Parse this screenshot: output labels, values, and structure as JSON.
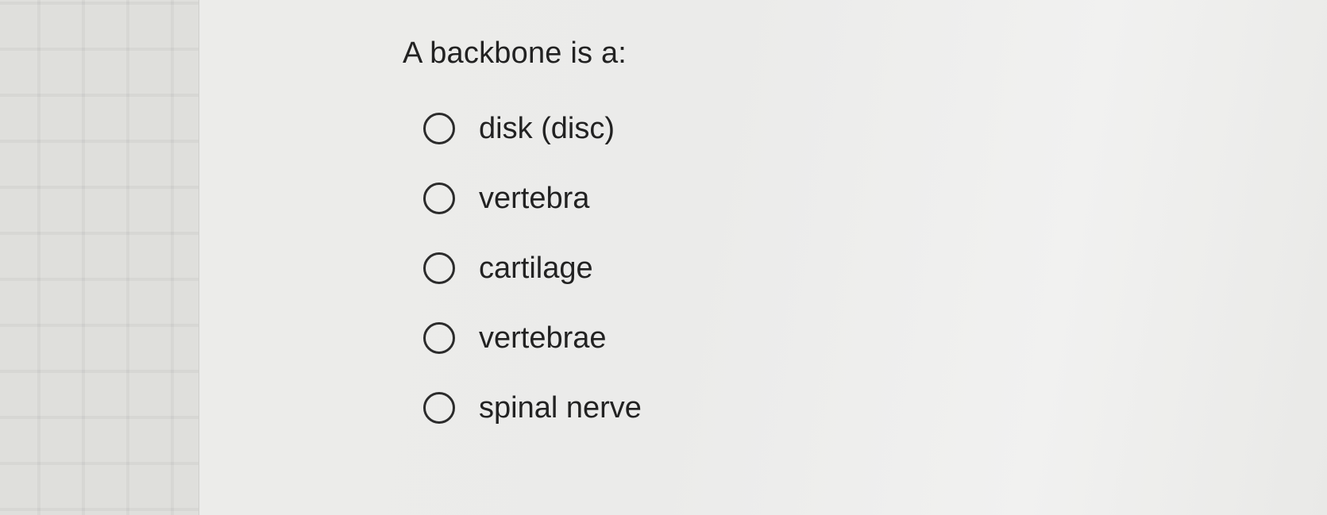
{
  "quiz": {
    "question": "A backbone is a:",
    "options": [
      {
        "label": "disk (disc)",
        "selected": false
      },
      {
        "label": "vertebra",
        "selected": false
      },
      {
        "label": "cartilage",
        "selected": false
      },
      {
        "label": "vertebrae",
        "selected": false
      },
      {
        "label": "spinal nerve",
        "selected": false
      }
    ]
  }
}
